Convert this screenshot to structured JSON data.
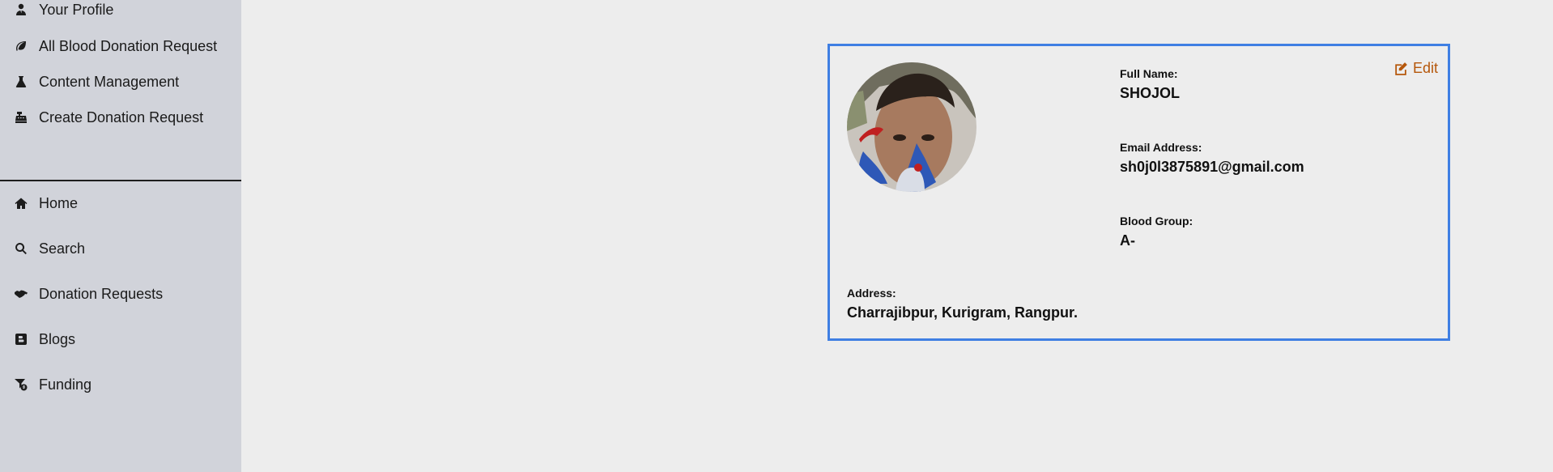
{
  "sidebar": {
    "dashboard_items": [
      {
        "label": "Your Profile",
        "icon": "user-tie-icon"
      },
      {
        "label": "All Blood Donation Request",
        "icon": "leaf-icon"
      },
      {
        "label": "Content Management",
        "icon": "flask-icon"
      },
      {
        "label": "Create Donation Request",
        "icon": "cash-register-icon"
      }
    ],
    "main_items": [
      {
        "label": "Home",
        "icon": "home-icon"
      },
      {
        "label": "Search",
        "icon": "search-icon"
      },
      {
        "label": "Donation Requests",
        "icon": "handshake-icon"
      },
      {
        "label": "Blogs",
        "icon": "blogger-icon"
      },
      {
        "label": "Funding",
        "icon": "funnel-dollar-icon"
      }
    ]
  },
  "profile": {
    "edit_label": "Edit",
    "full_name_label": "Full Name:",
    "full_name": "SHOJOL",
    "email_label": "Email Address:",
    "email": "sh0j0l3875891@gmail.com",
    "blood_group_label": "Blood Group:",
    "blood_group": "A-",
    "address_label": "Address:",
    "address": "Charrajibpur, Kurigram, Rangpur."
  },
  "colors": {
    "sidebar_bg": "#d1d3da",
    "page_bg": "#ededed",
    "card_border": "#3f7fe3",
    "edit_color": "#b5570b"
  }
}
